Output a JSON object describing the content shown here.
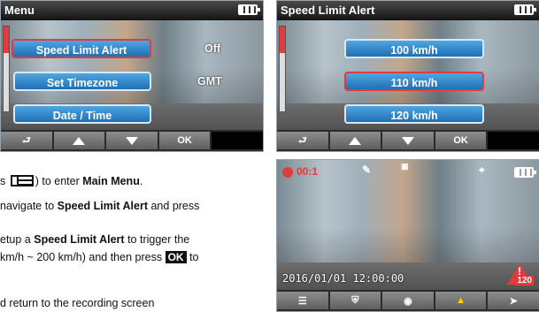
{
  "screen1": {
    "title": "Menu",
    "items": [
      {
        "label": "Speed Limit Alert",
        "value": "Off"
      },
      {
        "label": "Set Timezone",
        "value": "GMT"
      },
      {
        "label": "Date / Time",
        "value": ""
      }
    ],
    "buttons": {
      "ok": "OK"
    }
  },
  "screen2": {
    "title": "Speed Limit Alert",
    "options": [
      "100 km/h",
      "110 km/h",
      "120 km/h"
    ],
    "buttons": {
      "ok": "OK"
    }
  },
  "screen3": {
    "rec_time": "00:1",
    "timestamp": "2016/01/01  12:00:00",
    "speed_warning": "120"
  },
  "instructions": {
    "line1_pre": "s",
    "line1_post": ") to enter",
    "line1_bold": "Main Menu",
    "line1_end": ".",
    "line2_pre": "navigate to",
    "line2_bold": "Speed Limit Alert",
    "line2_post": "and press",
    "line3_pre": "etup a",
    "line3_bold": "Speed Limit Alert",
    "line3_post": "to trigger the",
    "line4_pre": "km/h ~ 200 km/h) and then press",
    "line4_ok": "OK",
    "line4_post": "to",
    "line5": "d return to the recording screen"
  }
}
